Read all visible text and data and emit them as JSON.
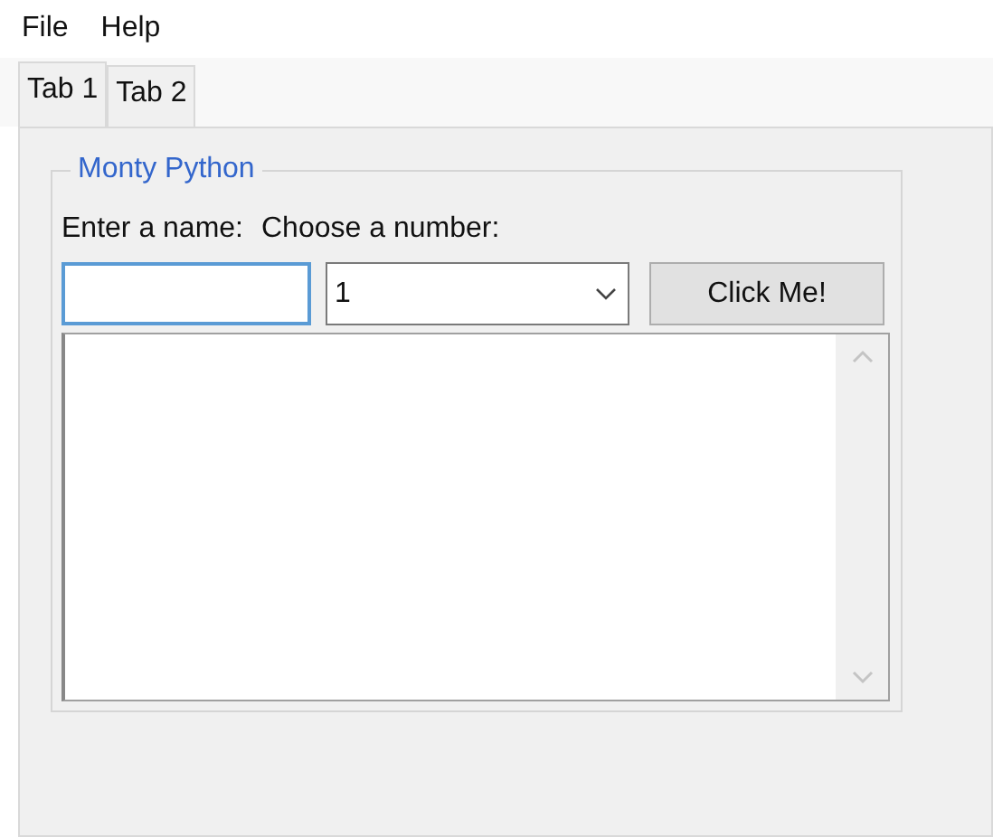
{
  "menu": [
    "File",
    "Help"
  ],
  "tabs": [
    {
      "label": "Tab 1",
      "selected": true
    },
    {
      "label": "Tab 2",
      "selected": false
    }
  ],
  "group": {
    "title": "Monty Python",
    "name_label": "Enter a name:",
    "number_label": "Choose a number:",
    "name_field": {
      "focused": true
    },
    "number_combo": {
      "value": "1"
    },
    "button": "Click Me!"
  }
}
